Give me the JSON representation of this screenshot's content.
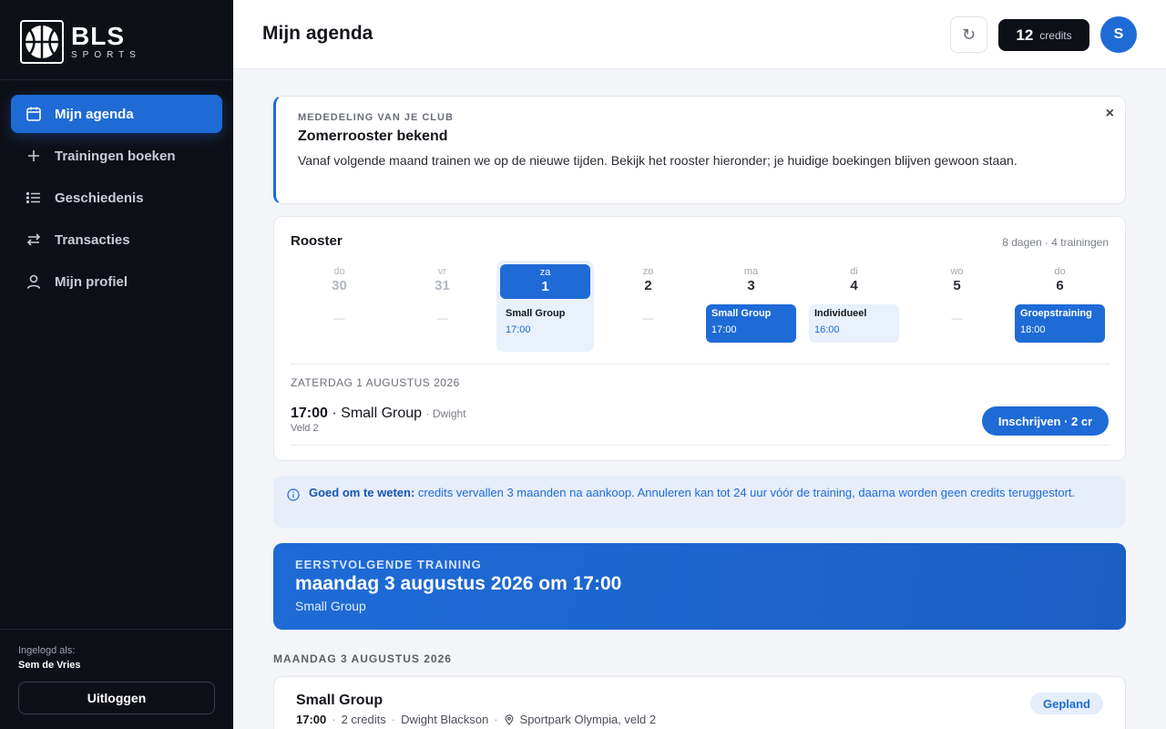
{
  "brand": {
    "name": "BLS",
    "tagline": "SPORTS"
  },
  "sidebar": {
    "items": [
      {
        "label": "Mijn agenda",
        "icon": "calendar-icon",
        "active": true
      },
      {
        "label": "Trainingen boeken",
        "icon": "plus-icon"
      },
      {
        "label": "Geschiedenis",
        "icon": "list-icon"
      },
      {
        "label": "Transacties",
        "icon": "swap-icon"
      },
      {
        "label": "Mijn profiel",
        "icon": "user-icon"
      }
    ],
    "logged_in_label": "Ingelogd als:",
    "user_name": "Sem de Vries",
    "logout_label": "Uitloggen"
  },
  "header": {
    "title": "Mijn agenda",
    "refresh_icon": "↻",
    "credits_count": "12",
    "credits_label": "credits",
    "avatar_initial": "S"
  },
  "announcement": {
    "kicker": "MEDEDELING VAN JE CLUB",
    "title": "Zomerrooster bekend",
    "body": "Vanaf volgende maand trainen we op de nieuwe tijden. Bekijk het rooster hieronder; je huidige boekingen blijven gewoon staan.",
    "close": "×"
  },
  "rooster": {
    "title": "Rooster",
    "summary": "8 dagen · 4 trainingen",
    "days": [
      {
        "name": "do",
        "num": "30",
        "empty": "—"
      },
      {
        "name": "vr",
        "num": "31",
        "empty": "—"
      },
      {
        "name": "za",
        "num": "1",
        "event": {
          "name": "Small Group",
          "time": "17:00"
        }
      },
      {
        "name": "zo",
        "num": "2",
        "empty": "—"
      },
      {
        "name": "ma",
        "num": "3",
        "event": {
          "name": "Small Group",
          "time": "17:00"
        }
      },
      {
        "name": "di",
        "num": "4",
        "event": {
          "name": "Individueel",
          "time": "16:00"
        }
      },
      {
        "name": "wo",
        "num": "5",
        "empty": "—"
      },
      {
        "name": "do",
        "num": "6",
        "event": {
          "name": "Groepstraining",
          "time": "18:00"
        }
      }
    ],
    "selected": {
      "date": "ZATERDAG 1 AUGUSTUS 2026",
      "time": "17:00",
      "separator": " · ",
      "name": "Small Group",
      "trainer": "· Dwight",
      "field": "Veld 2",
      "button": "Inschrijven · 2 cr"
    }
  },
  "info": {
    "bold": "Goed om te weten:",
    "text": " credits vervallen 3 maanden na aankoop. Annuleren kan tot 24 uur vóór de training, daarna worden geen credits teruggestort."
  },
  "next_training": {
    "kicker": "EERSTVOLGENDE TRAINING",
    "title": "maandag 3 augustus 2026 om 17:00",
    "sub": "Small Group"
  },
  "day_heading": "MAANDAG 3 AUGUSTUS 2026",
  "card": {
    "title": "Small Group",
    "time": "17:00",
    "credits": "2 credits",
    "trainer": "Dwight Blackson",
    "location": "Sportpark Olympia, veld 2",
    "status": "Gepland",
    "dot": "·"
  },
  "colors": {
    "accent": "#1e6bd6",
    "sidebar": "#0e1017"
  }
}
